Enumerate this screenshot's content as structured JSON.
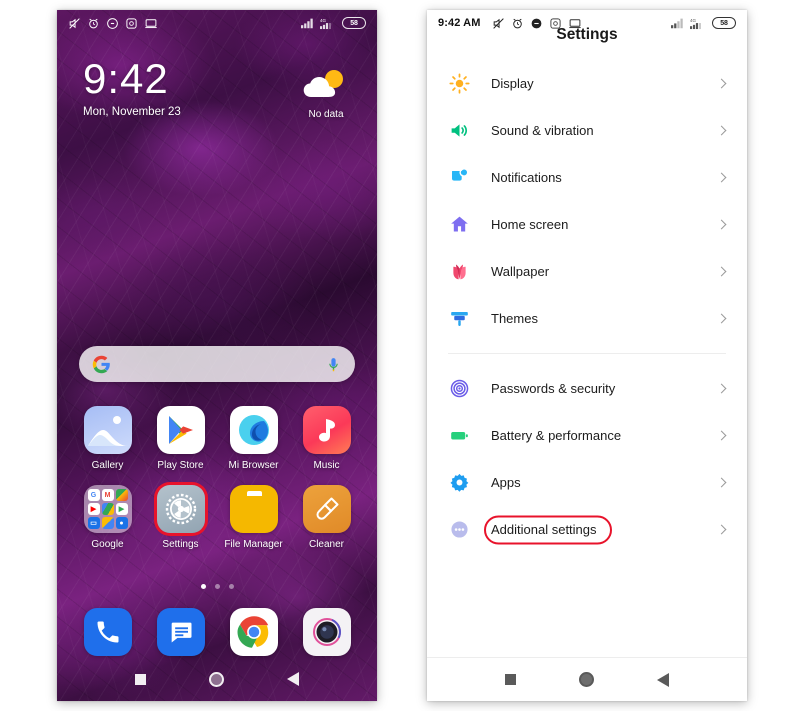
{
  "home_screen": {
    "status_bar": {
      "icons": [
        "mute-icon",
        "alarm-icon",
        "dnd-icon",
        "screen-recorder-icon",
        "cast-icon"
      ],
      "signal_label": "4G",
      "battery_level": "58"
    },
    "clock": {
      "time": "9:42",
      "date": "Mon, November 23"
    },
    "weather": {
      "label": "No data",
      "icon": "sun-behind-cloud-icon"
    },
    "search": {
      "placeholder": "",
      "logo": "google-g-icon",
      "mic": "microphone-icon"
    },
    "apps": [
      [
        {
          "label": "Gallery",
          "icon": "gallery-icon"
        },
        {
          "label": "Play Store",
          "icon": "play-store-icon"
        },
        {
          "label": "Mi Browser",
          "icon": "mi-browser-icon"
        },
        {
          "label": "Music",
          "icon": "music-icon"
        }
      ],
      [
        {
          "label": "Google",
          "icon": "google-folder-icon"
        },
        {
          "label": "Settings",
          "icon": "settings-gear-icon",
          "selected": true
        },
        {
          "label": "File Manager",
          "icon": "file-manager-icon"
        },
        {
          "label": "Cleaner",
          "icon": "cleaner-icon"
        }
      ]
    ],
    "folder_apps": [
      "Google",
      "Gmail",
      "Maps",
      "YouTube",
      "Drive",
      "Play",
      "Meet",
      "Photos",
      "Contacts"
    ],
    "page_dots": {
      "count": 3,
      "active_index": 0
    },
    "dock": [
      {
        "label": "Phone",
        "icon": "phone-icon"
      },
      {
        "label": "Messages",
        "icon": "messages-icon"
      },
      {
        "label": "Chrome",
        "icon": "chrome-icon"
      },
      {
        "label": "Camera",
        "icon": "camera-icon"
      }
    ],
    "nav_bar": {
      "recents": "recents-square-icon",
      "home": "home-circle-icon",
      "back": "back-triangle-icon"
    }
  },
  "settings_screen": {
    "status_bar": {
      "time": "9:42 AM",
      "icons": [
        "mute-icon",
        "alarm-icon",
        "dnd-icon",
        "screen-recorder-icon",
        "cast-icon"
      ],
      "signal_label": "4G",
      "battery_level": "58"
    },
    "title": "Settings",
    "groups": [
      {
        "items": [
          {
            "label": "Display",
            "icon": "brightness-sun-icon",
            "color": "#ffa726"
          },
          {
            "label": "Sound & vibration",
            "icon": "speaker-icon",
            "color": "#00c07f"
          },
          {
            "label": "Notifications",
            "icon": "notification-badge-icon",
            "color": "#29b6f6"
          },
          {
            "label": "Home screen",
            "icon": "house-icon",
            "color": "#7e6ef0"
          },
          {
            "label": "Wallpaper",
            "icon": "flower-icon",
            "color": "#f0486e"
          },
          {
            "label": "Themes",
            "icon": "paintbrush-icon",
            "color": "#29a7f0"
          }
        ]
      },
      {
        "items": [
          {
            "label": "Passwords & security",
            "icon": "fingerprint-icon",
            "color": "#6a5ce8"
          },
          {
            "label": "Battery & performance",
            "icon": "battery-icon",
            "color": "#26d07c"
          },
          {
            "label": "Apps",
            "icon": "gear-icon",
            "color": "#1e9df0"
          },
          {
            "label": "Additional settings",
            "icon": "more-dots-icon",
            "color": "#a5a8e8",
            "highlighted": true
          }
        ]
      }
    ],
    "highlight_color": "#e8132b",
    "nav_bar": {
      "recents": "recents-square-icon",
      "home": "home-circle-icon",
      "back": "back-triangle-icon"
    }
  }
}
